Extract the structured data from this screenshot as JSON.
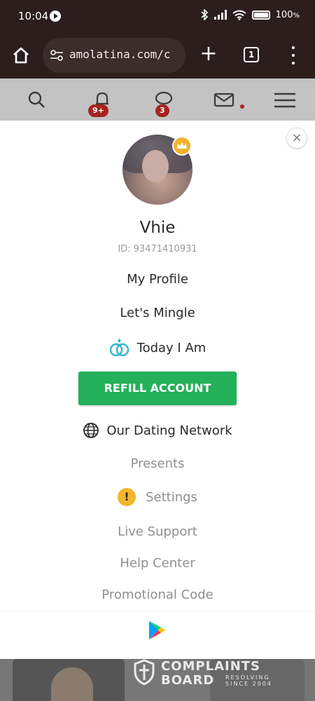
{
  "status_bar": {
    "time": "10:04",
    "battery": "100"
  },
  "browser": {
    "url": "amolatina.com/c",
    "tab_count": "1"
  },
  "site_nav": {
    "notifications_badge": "9+",
    "chat_badge": "3"
  },
  "profile_menu": {
    "close_label": "×",
    "username": "Vhie",
    "user_id": "ID: 93471410931",
    "items": {
      "my_profile": "My Profile",
      "lets_mingle": "Let's Mingle",
      "today_i_am": "Today I Am",
      "refill": "REFILL ACCOUNT",
      "dating_network": "Our Dating Network",
      "presents": "Presents",
      "settings": "Settings",
      "live_support": "Live Support",
      "help_center": "Help Center",
      "promo_code": "Promotional Code"
    },
    "settings_alert_glyph": "!"
  },
  "watermark": {
    "line1": "COMPLAINTS",
    "line2": "BOARD",
    "side1": "RESOLVING",
    "side2": "SINCE 2004"
  },
  "colors": {
    "refill_green": "#25b05a",
    "badge_red": "#a6241f",
    "crown_gold": "#f3b22b",
    "warning_yellow": "#f2b52c",
    "rings_teal": "#31b6c9"
  }
}
